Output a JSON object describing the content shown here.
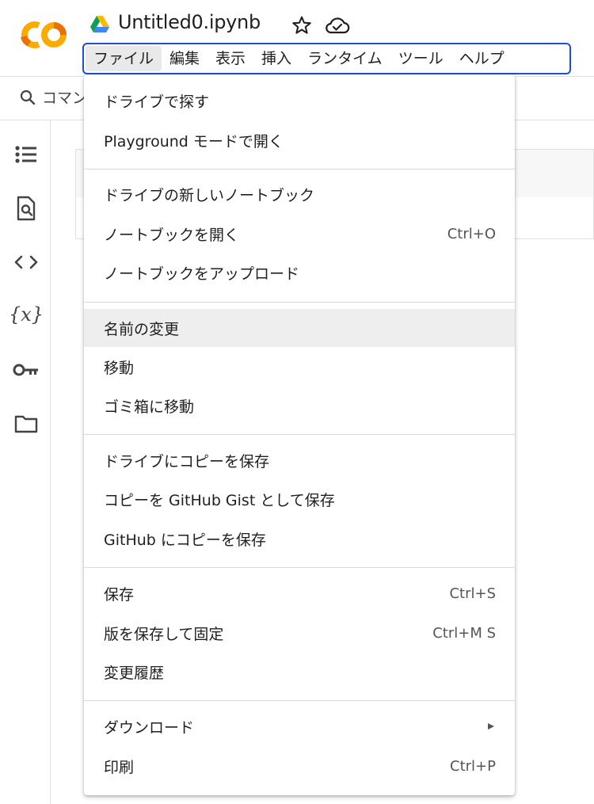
{
  "header": {
    "title": "Untitled0.ipynb",
    "logo_text": "CO"
  },
  "menubar": {
    "items": [
      {
        "label": "ファイル"
      },
      {
        "label": "編集"
      },
      {
        "label": "表示"
      },
      {
        "label": "挿入"
      },
      {
        "label": "ランタイム"
      },
      {
        "label": "ツール"
      },
      {
        "label": "ヘルプ"
      }
    ]
  },
  "toolbar": {
    "command_label": "コマン"
  },
  "dropdown": {
    "items": [
      {
        "label": "ドライブで探す",
        "shortcut": ""
      },
      {
        "label": "Playground モードで開く",
        "shortcut": ""
      },
      {
        "label": "ドライブの新しいノートブック",
        "shortcut": ""
      },
      {
        "label": "ノートブックを開く",
        "shortcut": "Ctrl+O"
      },
      {
        "label": "ノートブックをアップロード",
        "shortcut": ""
      },
      {
        "label": "名前の変更",
        "shortcut": ""
      },
      {
        "label": "移動",
        "shortcut": ""
      },
      {
        "label": "ゴミ箱に移動",
        "shortcut": ""
      },
      {
        "label": "ドライブにコピーを保存",
        "shortcut": ""
      },
      {
        "label": "コピーを GitHub Gist として保存",
        "shortcut": ""
      },
      {
        "label": "GitHub にコピーを保存",
        "shortcut": ""
      },
      {
        "label": "保存",
        "shortcut": "Ctrl+S"
      },
      {
        "label": "版を保存して固定",
        "shortcut": "Ctrl+M S"
      },
      {
        "label": "変更履歴",
        "shortcut": ""
      },
      {
        "label": "ダウンロード",
        "shortcut": ""
      },
      {
        "label": "印刷",
        "shortcut": "Ctrl+P"
      }
    ]
  },
  "colors": {
    "menubar_outline": "#1a4fd6",
    "colab_orange": "#f9ab00",
    "colab_dark_orange": "#e8710a",
    "highlight": "#eeeeee"
  }
}
